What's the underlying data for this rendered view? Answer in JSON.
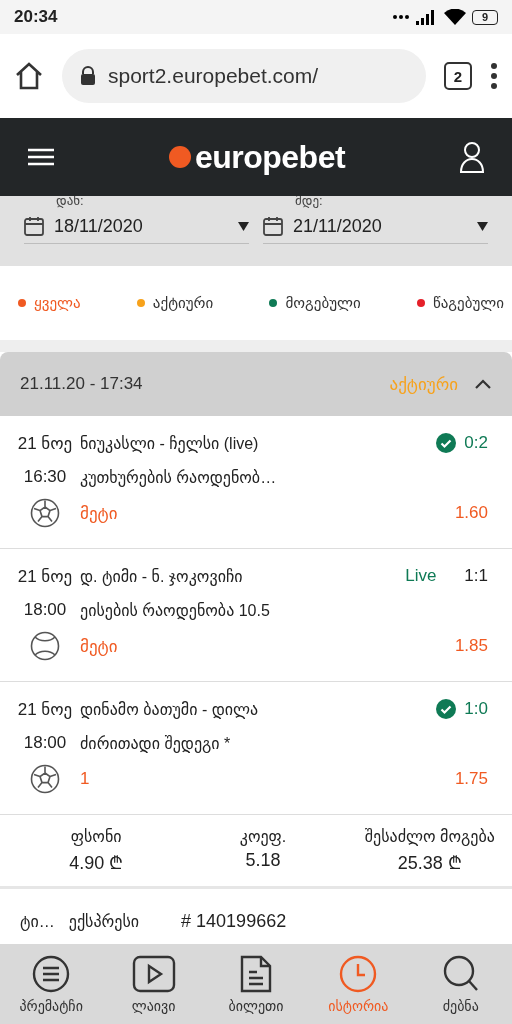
{
  "status_bar": {
    "time": "20:34",
    "battery": "9"
  },
  "browser": {
    "url": "sport2.europebet.com/",
    "tab_count": "2"
  },
  "header": {
    "logo": "europebet"
  },
  "date_range": [
    {
      "label": "დან:",
      "value": "18/11/2020"
    },
    {
      "label": "მდე:",
      "value": "21/11/2020"
    }
  ],
  "filters": [
    {
      "label": "ყველა",
      "color": "#f05a22",
      "selected": true
    },
    {
      "label": "აქტიური",
      "color": "#f7a21b",
      "selected": false
    },
    {
      "label": "მოგებული",
      "color": "#0f7a55",
      "selected": false
    },
    {
      "label": "წაგებული",
      "color": "#e5202a",
      "selected": false
    }
  ],
  "ticket": {
    "datetime": "21.11.20 - 17:34",
    "status": "აქტიური",
    "expanded": true,
    "bets": [
      {
        "date": "21 ნოე",
        "time": "16:30",
        "kind": "football",
        "match": "ნიუკასლი - ჩელსი (live)",
        "won": true,
        "score": "0:2",
        "market": "კუთხურების რაოდენობ…",
        "pick": "მეტი",
        "odds": "1.60"
      },
      {
        "date": "21 ნოე",
        "time": "18:00",
        "kind": "tennis",
        "match": "დ. ტიმი - ნ. ჯოკოვიჩი",
        "won": false,
        "live_label": "Live",
        "score": "1:1",
        "market": "ეისების რაოდენობა 10.5",
        "pick": "მეტი",
        "odds": "1.85"
      },
      {
        "date": "21 ნოე",
        "time": "18:00",
        "kind": "football",
        "match": "დინამო ბათუმი - დილა",
        "won": true,
        "score": "1:0",
        "market": "ძირითადი შედეგი *",
        "pick": "1",
        "odds": "1.75"
      }
    ],
    "summary": [
      {
        "label": "ფსონი",
        "value": "4.90 ₾"
      },
      {
        "label": "კოეფ.",
        "value": "5.18"
      },
      {
        "label": "შესაძლო მოგება",
        "value": "25.38 ₾"
      }
    ],
    "type_label": "ტი…",
    "type": "ექსპრესი",
    "number": "# 140199662"
  },
  "bottom_nav": [
    {
      "label": "პრემატჩი",
      "selected": false
    },
    {
      "label": "ლაივი",
      "selected": false
    },
    {
      "label": "ბილეთი",
      "selected": false
    },
    {
      "label": "ისტორია",
      "selected": true
    },
    {
      "label": "ძებნა",
      "selected": false
    }
  ]
}
